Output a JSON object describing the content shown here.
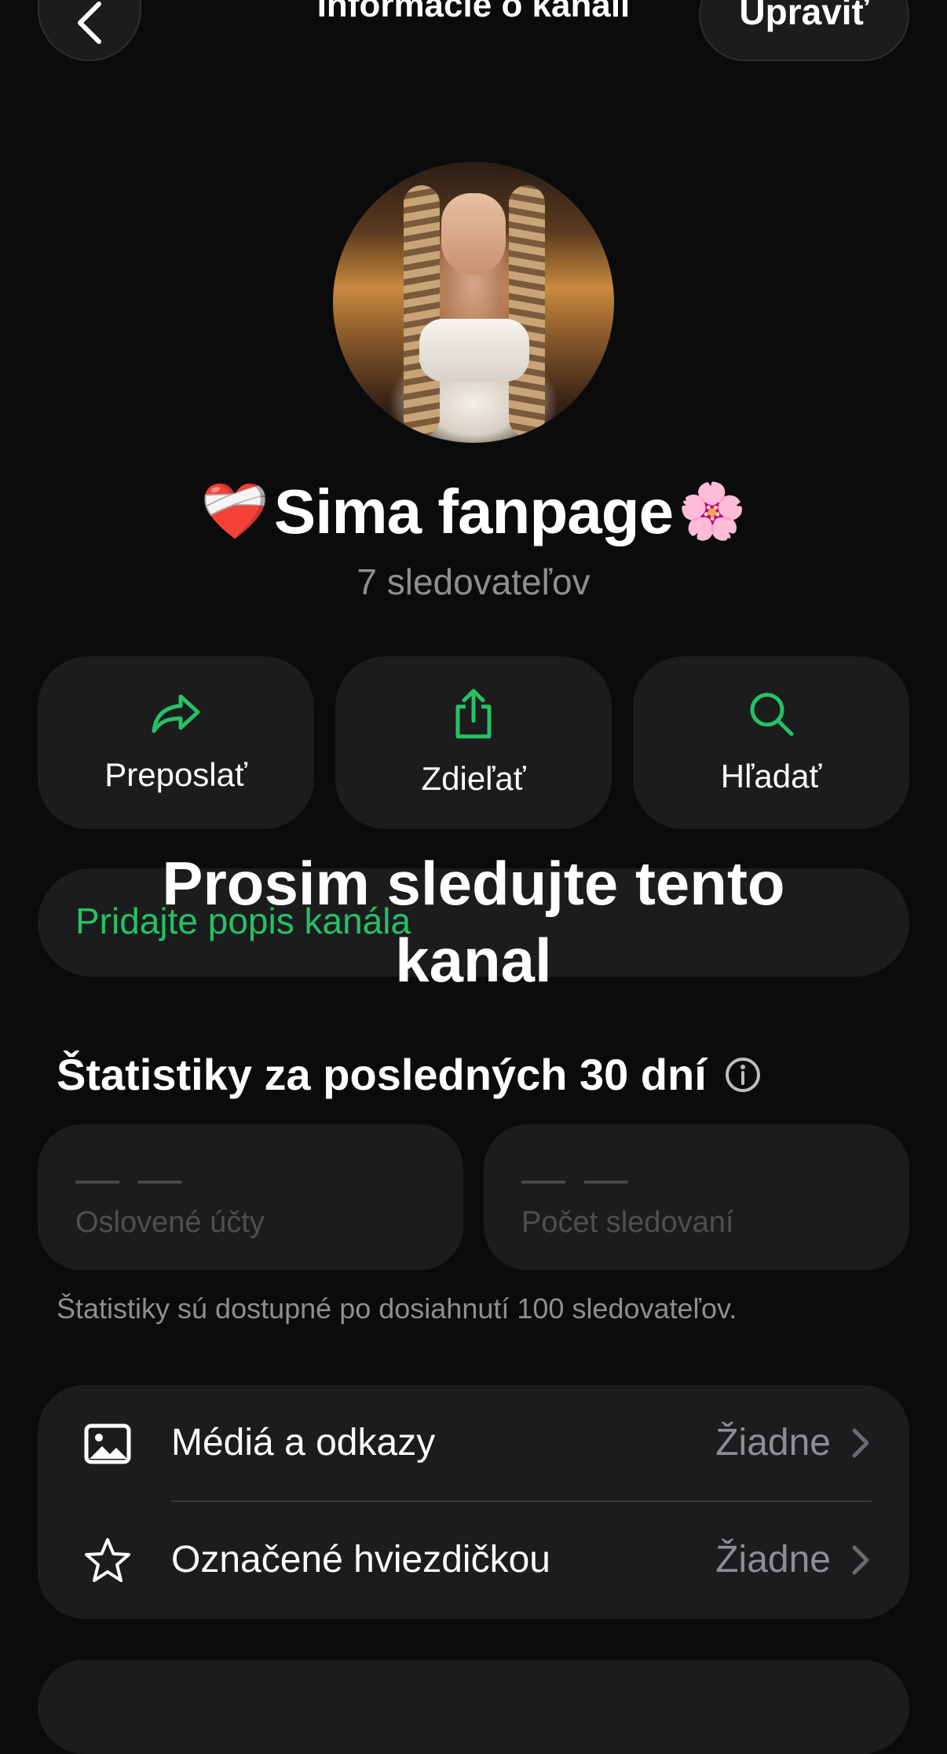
{
  "header": {
    "title": "Informácie o kanáli",
    "edit_label": "Upraviť"
  },
  "channel": {
    "name": "Sima fanpage",
    "name_prefix_emoji": "❤️‍🩹",
    "name_suffix_emoji": "🌸",
    "followers": "7 sledovateľov"
  },
  "actions": [
    {
      "label": "Preposlať",
      "icon": "forward-icon"
    },
    {
      "label": "Zdieľať",
      "icon": "share-icon"
    },
    {
      "label": "Hľadať",
      "icon": "search-icon"
    }
  ],
  "description": {
    "placeholder": "Pridajte popis kanála"
  },
  "overlay_caption": {
    "line1": "Prosim sledujte tento",
    "line2": "kanal"
  },
  "stats": {
    "title": "Štatistiky za posledných 30 dní",
    "cards": [
      {
        "value": "— —",
        "label": "Oslovené účty"
      },
      {
        "value": "— —",
        "label": "Počet sledovaní"
      }
    ],
    "note": "Štatistiky sú dostupné po dosiahnutí 100 sledovateľov."
  },
  "list": [
    {
      "label": "Médiá a odkazy",
      "value": "Žiadne",
      "icon": "image-icon"
    },
    {
      "label": "Označené hviezdičkou",
      "value": "Žiadne",
      "icon": "star-icon"
    }
  ],
  "colors": {
    "accent": "#25c265",
    "background": "#0b0b0b",
    "card": "#1c1c1e",
    "secondary_text": "#8e8e93"
  }
}
